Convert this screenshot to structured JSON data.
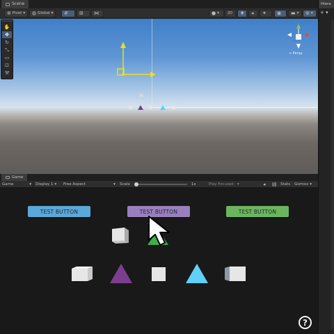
{
  "scene": {
    "tab_label": "Scene",
    "toolbar": {
      "pivot_label": "Pivot",
      "global_label": "Global"
    },
    "perspective_label": "< Persp"
  },
  "right_dock": {
    "tab_label": "Hiera",
    "add_label": "+ ▾"
  },
  "game": {
    "tab_label": "Game",
    "toolbar": {
      "view_label": "Game",
      "display_label": "Display 1",
      "aspect_label": "Free Aspect",
      "scale_label": "Scale",
      "scale_value": "1x",
      "play_mode_label": "Play Focused",
      "stats_label": "Stats",
      "gizmos_label": "Gizmos"
    },
    "buttons": [
      {
        "label": "TEST BUTTON",
        "color": "#5aa9d8"
      },
      {
        "label": "TEST BUTTON",
        "color": "#9a7fbd"
      },
      {
        "label": "TEST BUTTON",
        "color": "#6cb55f"
      }
    ],
    "help_icon": "?"
  },
  "colors": {
    "cyan": "#5fd1f7",
    "purple": "#7c3f8f",
    "green": "#3dae4e",
    "cube_face": "#e6e6e6",
    "panel_bg": "#191919"
  }
}
